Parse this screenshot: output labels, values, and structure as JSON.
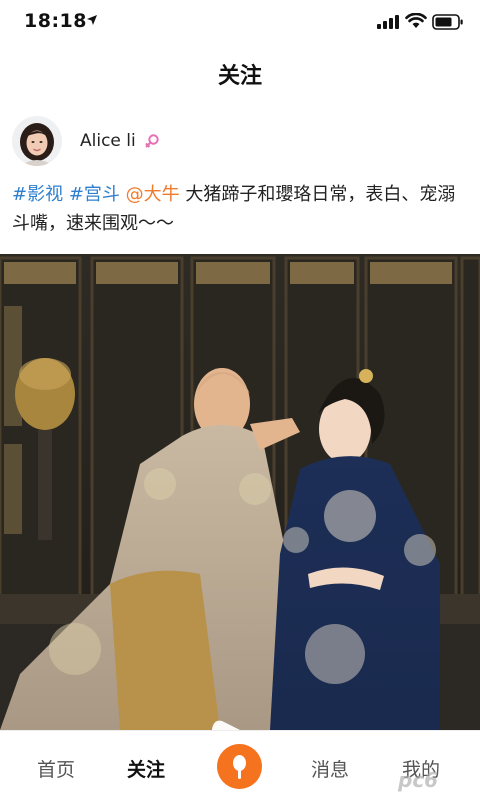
{
  "status_bar": {
    "time": "18:18",
    "icons": [
      "location-arrow-icon",
      "signal-icon",
      "wifi-icon",
      "battery-icon"
    ]
  },
  "header": {
    "title": "关注"
  },
  "post": {
    "user": {
      "name": "Alice li",
      "gender": "female"
    },
    "text": {
      "tags": [
        "#影视",
        "#宫斗"
      ],
      "mention": "@大牛",
      "body": " 大猪蹄子和瓔珞日常，表白、宠溺斗嘴，速来围观～～"
    },
    "media": {
      "type": "video",
      "play_icon": "play-icon"
    }
  },
  "tab_bar": {
    "tabs": [
      "首页",
      "关注",
      "消息",
      "我的"
    ],
    "active": "关注",
    "center_icon": "microphone-icon"
  },
  "watermark": "pc6",
  "colors": {
    "accent": "#f5731f",
    "tag": "#2f7fcf",
    "mention": "#f07a2c",
    "gender": "#e86fb3"
  }
}
